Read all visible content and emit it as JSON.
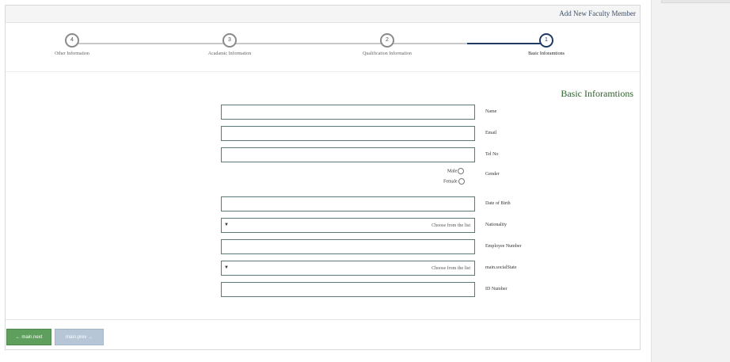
{
  "header": {
    "title": "Add New Faculty Member"
  },
  "stepper": {
    "steps": [
      {
        "number": "4",
        "label": "Other Information"
      },
      {
        "number": "3",
        "label": "Acadamic Information"
      },
      {
        "number": "2",
        "label": "Qualification Information"
      },
      {
        "number": "1",
        "label": "Basic Inforamtions"
      }
    ],
    "active_step": "1"
  },
  "form": {
    "section_title": "Basic Inforamtions",
    "fields": {
      "name": {
        "label": "Name",
        "value": ""
      },
      "email": {
        "label": "Email",
        "value": ""
      },
      "tel": {
        "label": "Tel No",
        "value": ""
      },
      "gender": {
        "label": "Gender",
        "options": [
          "Male",
          "Female"
        ]
      },
      "dob": {
        "label": "Date of Birth",
        "value": ""
      },
      "nationality": {
        "label": "Nationality",
        "selected": "Choose from the list"
      },
      "employee_number": {
        "label": "Employee Number",
        "value": ""
      },
      "social_state": {
        "label": "main.socialState",
        "selected": "Choose from the list"
      },
      "id_number": {
        "label": "ID Number",
        "value": ""
      }
    }
  },
  "buttons": {
    "next_label": "main.next",
    "prev_label": "main.prev",
    "next_icon": "arrow-left-icon",
    "prev_icon": "arrow-right-icon"
  },
  "colors": {
    "accent_blue": "#1f3a64",
    "section_green": "#2d5f2d",
    "next_button": "#5e9f5e",
    "prev_button": "#b6c6d6"
  }
}
